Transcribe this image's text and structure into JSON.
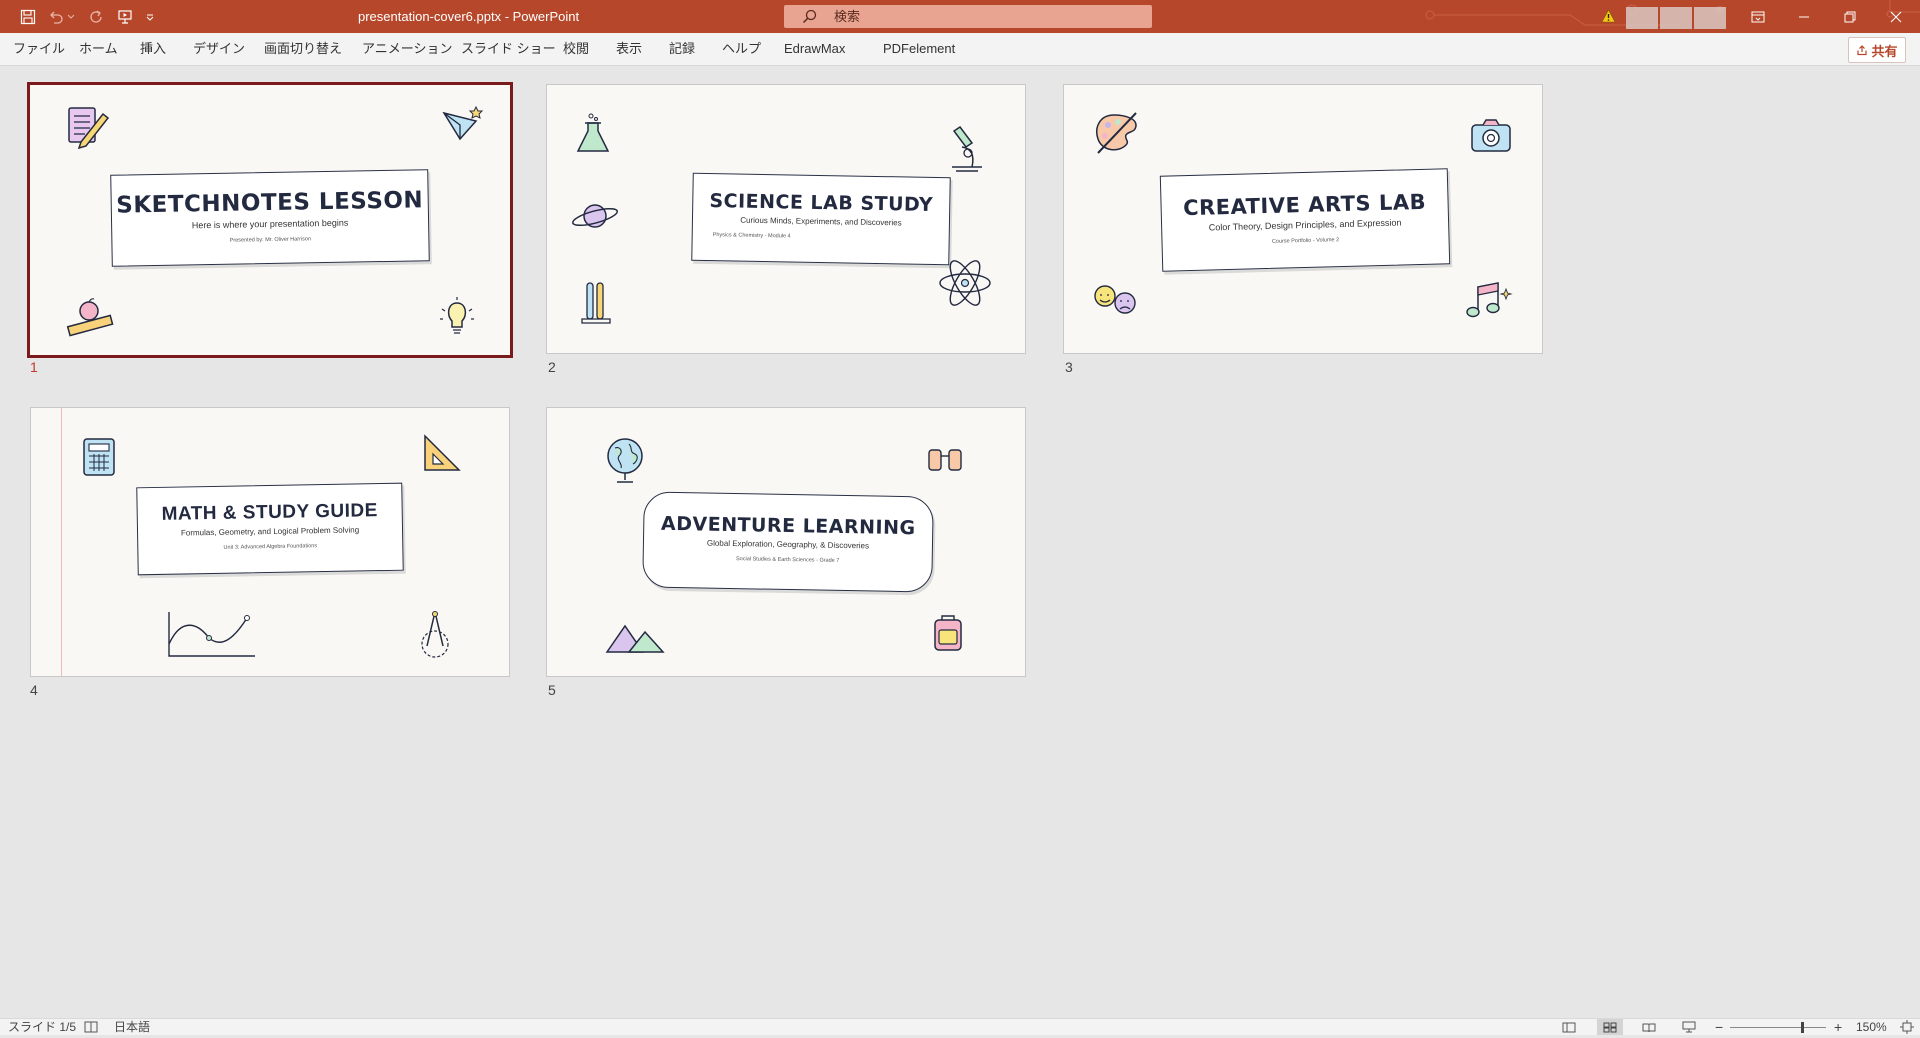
{
  "app": {
    "document_title": "presentation-cover6.pptx  -  PowerPoint",
    "search_placeholder": "検索",
    "share_label": "共有"
  },
  "menu": [
    "ファイル",
    "ホーム",
    "挿入",
    "デザイン",
    "画面切り替え",
    "アニメーション",
    "スライド ショー",
    "校閲",
    "表示",
    "記録",
    "ヘルプ",
    "EdrawMax",
    "PDFelement"
  ],
  "slides": [
    {
      "number": "1",
      "title": "SKETCHNOTES LESSON",
      "subtitle": "Here is where your presentation begins",
      "meta": "Presented by: Mr. Oliver Harrison"
    },
    {
      "number": "2",
      "title": "SCIENCE LAB STUDY",
      "subtitle": "Curious Minds, Experiments, and Discoveries",
      "meta": "Physics & Chemistry - Module 4"
    },
    {
      "number": "3",
      "title": "CREATIVE ARTS LAB",
      "subtitle": "Color Theory, Design Principles, and Expression",
      "meta": "Course Portfolio - Volume 2"
    },
    {
      "number": "4",
      "title": "MATH & STUDY GUIDE",
      "subtitle": "Formulas, Geometry, and Logical Problem Solving",
      "meta": "Unit 3: Advanced Algebra Foundations"
    },
    {
      "number": "5",
      "title": "ADVENTURE LEARNING",
      "subtitle": "Global Exploration, Geography, & Discoveries",
      "meta": "Social Studies & Earth Sciences - Grade 7"
    }
  ],
  "status": {
    "slide_indicator": "スライド 1/5",
    "language": "日本語",
    "zoom": "150%"
  },
  "colors": {
    "titlebar": "#b7472a",
    "selection": "#7b1a1a",
    "slide_bg": "#faf8f4",
    "ink": "#232a40"
  }
}
